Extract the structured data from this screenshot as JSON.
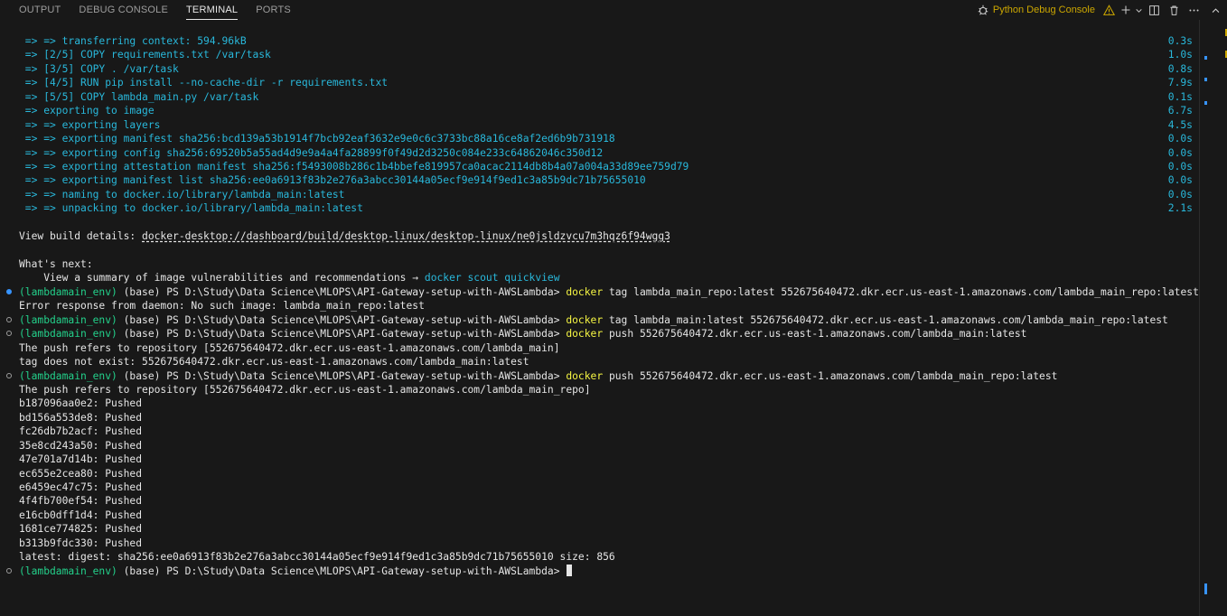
{
  "tabs": [
    {
      "label": "OUTPUT",
      "active": false
    },
    {
      "label": "DEBUG CONSOLE",
      "active": false
    },
    {
      "label": "TERMINAL",
      "active": true
    },
    {
      "label": "PORTS",
      "active": false
    }
  ],
  "header": {
    "debug_console_label": "Python Debug Console"
  },
  "build_lines": [
    {
      "text": " => => transferring context: 594.96kB",
      "time": "0.3s"
    },
    {
      "text": " => [2/5] COPY requirements.txt /var/task",
      "time": "1.0s"
    },
    {
      "text": " => [3/5] COPY . /var/task",
      "time": "0.8s"
    },
    {
      "text": " => [4/5] RUN pip install --no-cache-dir -r requirements.txt",
      "time": "7.9s"
    },
    {
      "text": " => [5/5] COPY lambda_main.py /var/task",
      "time": "0.1s"
    },
    {
      "text": " => exporting to image",
      "time": "6.7s"
    },
    {
      "text": " => => exporting layers",
      "time": "4.5s"
    },
    {
      "text": " => => exporting manifest sha256:bcd139a53b1914f7bcb92eaf3632e9e0c6c3733bc88a16ce8af2ed6b9b731918",
      "time": "0.0s"
    },
    {
      "text": " => => exporting config sha256:69520b5a55ad4d9e9a4a4fa28899f0f49d2d3250c084e233c64862046c350d12",
      "time": "0.0s"
    },
    {
      "text": " => => exporting attestation manifest sha256:f5493008b286c1b4bbefe819957ca0acac2114db8b4a07a004a33d89ee759d79",
      "time": "0.0s"
    },
    {
      "text": " => => exporting manifest list sha256:ee0a6913f83b2e276a3abcc30144a05ecf9e914f9ed1c3a85b9dc71b75655010",
      "time": "0.0s"
    },
    {
      "text": " => => naming to docker.io/library/lambda_main:latest",
      "time": "0.0s"
    },
    {
      "text": " => => unpacking to docker.io/library/lambda_main:latest",
      "time": "2.1s"
    }
  ],
  "build_details": {
    "label": "View build details: ",
    "url": "docker-desktop://dashboard/build/desktop-linux/desktop-linux/ne0jsldzvcu7m3hqz6f94wgg3"
  },
  "whats_next": {
    "title": "What's next:",
    "text": "    View a summary of image vulnerabilities and recommendations → ",
    "cmd": "docker scout quickview"
  },
  "prompt": {
    "env": "(lambdamain_env)",
    "rest": " (base) PS D:\\Study\\Data Science\\MLOPS\\API-Gateway-setup-with-AWSLambda> "
  },
  "cmd1": {
    "cmd": "docker",
    "args": " tag lambda_main_repo:latest 552675640472.dkr.ecr.us-east-1.amazonaws.com/lambda_main_repo:latest"
  },
  "out1": [
    "Error response from daemon: No such image: lambda_main_repo:latest"
  ],
  "cmd2": {
    "cmd": "docker",
    "args": " tag lambda_main:latest 552675640472.dkr.ecr.us-east-1.amazonaws.com/lambda_main_repo:latest"
  },
  "cmd3": {
    "cmd": "docker",
    "args": " push 552675640472.dkr.ecr.us-east-1.amazonaws.com/lambda_main:latest"
  },
  "out3": [
    "The push refers to repository [552675640472.dkr.ecr.us-east-1.amazonaws.com/lambda_main]",
    "tag does not exist: 552675640472.dkr.ecr.us-east-1.amazonaws.com/lambda_main:latest"
  ],
  "cmd4": {
    "cmd": "docker",
    "args": " push 552675640472.dkr.ecr.us-east-1.amazonaws.com/lambda_main_repo:latest"
  },
  "out4": [
    "The push refers to repository [552675640472.dkr.ecr.us-east-1.amazonaws.com/lambda_main_repo]",
    "b187096aa0e2: Pushed",
    "bd156a553de8: Pushed",
    "fc26db7b2acf: Pushed",
    "35e8cd243a50: Pushed",
    "47e701a7d14b: Pushed",
    "ec655e2cea80: Pushed",
    "e6459ec47c75: Pushed",
    "4f4fb700ef54: Pushed",
    "e16cb0dff1d4: Pushed",
    "1681ce774825: Pushed",
    "b313b9fdc330: Pushed",
    "latest: digest: sha256:ee0a6913f83b2e276a3abcc30144a05ecf9e914f9ed1c3a85b9dc71b75655010 size: 856"
  ]
}
